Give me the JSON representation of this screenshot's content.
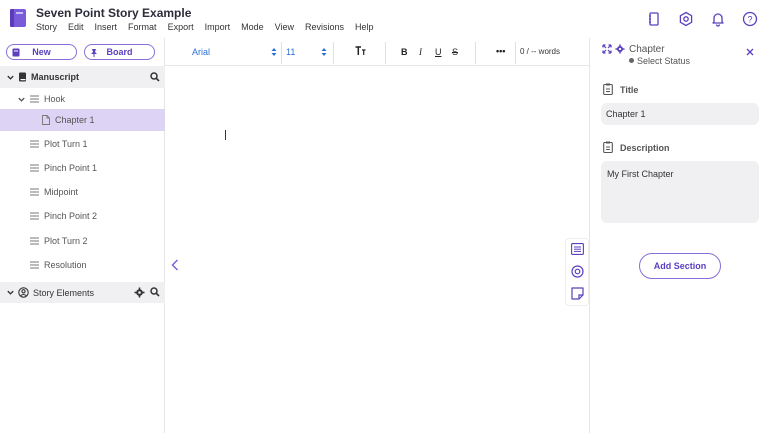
{
  "app": {
    "title": "Seven Point Story Example",
    "accent": "#6a4fcf"
  },
  "menu": [
    "Story",
    "Edit",
    "Insert",
    "Format",
    "Export",
    "Import",
    "Mode",
    "View",
    "Revisions",
    "Help"
  ],
  "header_icons": [
    "notebook-icon",
    "settings-icon",
    "bell-icon",
    "help-icon"
  ],
  "sidebar": {
    "new_label": "New",
    "board_label": "Board",
    "manuscript_label": "Manuscript",
    "items": [
      {
        "label": "Hook",
        "kind": "folder-open"
      },
      {
        "label": "Chapter 1",
        "kind": "document",
        "selected": true
      },
      {
        "label": "Plot Turn 1",
        "kind": "list"
      },
      {
        "label": "Pinch Point 1",
        "kind": "list"
      },
      {
        "label": "Midpoint",
        "kind": "list"
      },
      {
        "label": "Pinch Point 2",
        "kind": "list"
      },
      {
        "label": "Plot Turn 2",
        "kind": "list"
      },
      {
        "label": "Resolution",
        "kind": "list"
      }
    ],
    "story_elements_label": "Story Elements"
  },
  "toolbar": {
    "font": "Arial",
    "size": "11",
    "bold": "B",
    "italic": "I",
    "underline": "U",
    "strike": "S",
    "more": "•••",
    "word_count": "0 / -- words"
  },
  "panel": {
    "heading": "Chapter",
    "status": "Select Status",
    "title_label": "Title",
    "title_value": "Chapter 1",
    "description_label": "Description",
    "description_value": "My First Chapter",
    "add_section_label": "Add Section"
  }
}
